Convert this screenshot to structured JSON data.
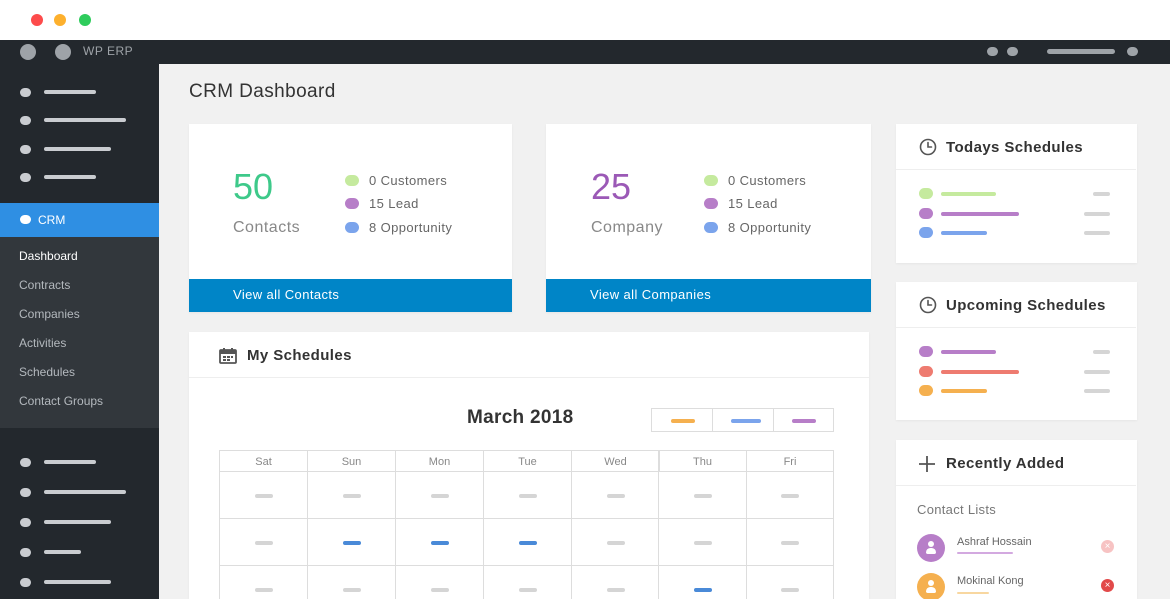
{
  "colors": {
    "green": "#3ec98a",
    "purple": "#9b59b6",
    "blue": "#0085c7",
    "customers_dot": "#c5ea9e",
    "lead_dot": "#b77ec8",
    "opportunity_dot": "#7ba4ec"
  },
  "adminbar": {
    "site_title": "WP ERP"
  },
  "sidebar": {
    "crm_label": "CRM",
    "sub_items": [
      "Dashboard",
      "Contracts",
      "Companies",
      "Activities",
      "Schedules",
      "Contact Groups"
    ]
  },
  "page": {
    "title": "CRM Dashboard"
  },
  "contacts_card": {
    "count": "50",
    "label": "Contacts",
    "legend": [
      "0 Customers",
      "15 Lead",
      "8 Opportunity"
    ],
    "footer": "View all Contacts"
  },
  "company_card": {
    "count": "25",
    "label": "Company",
    "legend": [
      "0 Customers",
      "15 Lead",
      "8 Opportunity"
    ],
    "footer": "View all Companies"
  },
  "my_schedules": {
    "title": "My Schedules",
    "month": "March 2018",
    "days": [
      "Sat",
      "Sun",
      "Mon",
      "Tue",
      "Wed",
      "Thu",
      "Fri"
    ]
  },
  "todays_schedules": {
    "title": "Todays Schedules"
  },
  "upcoming_schedules": {
    "title": "Upcoming Schedules"
  },
  "recently_added": {
    "title": "Recently Added",
    "subtitle": "Contact Lists",
    "contacts": [
      "Ashraf Hossain",
      "Mokinal Kong"
    ]
  }
}
